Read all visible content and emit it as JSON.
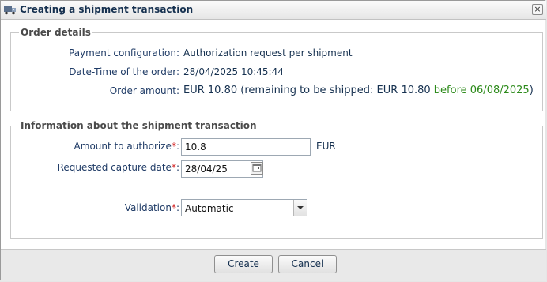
{
  "window": {
    "title": "Creating a shipment transaction",
    "icon": "truck-icon",
    "close_label": "×"
  },
  "order_details": {
    "legend": "Order details",
    "payment_configuration_label": "Payment configuration:",
    "payment_configuration_value": "Authorization request per shipment",
    "datetime_label": "Date-Time of the order:",
    "datetime_value": "28/04/2025 10:45:44",
    "amount_label": "Order amount:",
    "amount_value": "EUR 10.80 (remaining to be shipped: EUR 10.80",
    "amount_deadline": "before 06/08/2025",
    "amount_close": ")"
  },
  "shipment": {
    "legend": "Information about the shipment transaction",
    "amount_label": "Amount to authorize",
    "amount_value": "10.8",
    "currency": "EUR",
    "capture_label": "Requested capture date",
    "capture_value": "28/04/25",
    "validation_label": "Validation",
    "validation_value": "Automatic",
    "required_mark": "*",
    "colon": ":"
  },
  "buttons": {
    "create": "Create",
    "cancel": "Cancel"
  },
  "colors": {
    "required": "#d22020",
    "deadline": "#2c8a1a",
    "label": "#1f3b66"
  }
}
